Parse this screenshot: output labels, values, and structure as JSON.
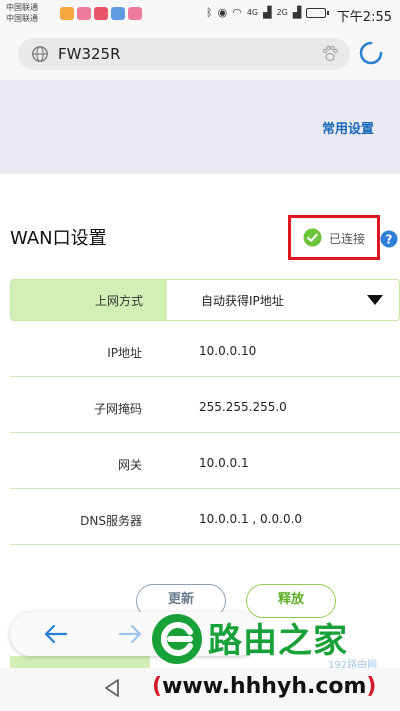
{
  "status_bar": {
    "carrier_line1": "中国联通",
    "carrier_line2": "中国联通",
    "signal1": "4G",
    "signal2": "2G",
    "time": "下午2:55"
  },
  "address_bar": {
    "url": "FW325R"
  },
  "banner": {
    "link_label": "常用设置"
  },
  "wan": {
    "title": "WAN口设置",
    "status": "已连接",
    "status_color": "#e01820",
    "connection_type_label": "上网方式",
    "connection_type_value": "自动获得IP地址",
    "fields": [
      {
        "label": "IP地址",
        "value": "10.0.0.10"
      },
      {
        "label": "子网掩码",
        "value": "255.255.255.0"
      },
      {
        "label": "网关",
        "value": "10.0.0.1"
      },
      {
        "label": "DNS服务器",
        "value": "10.0.0.1 , 0.0.0.0"
      }
    ]
  },
  "buttons": {
    "renew": "更新",
    "release": "释放"
  },
  "watermark": {
    "main": "路由之家",
    "small": "192路由网",
    "url": "www.hhhyh.com",
    "open_paren": "(",
    "close_paren": ")"
  },
  "colors": {
    "accent_green": "#8fcf4d",
    "link_blue": "#1b6ab8",
    "label_bg": "#d2efb6"
  }
}
